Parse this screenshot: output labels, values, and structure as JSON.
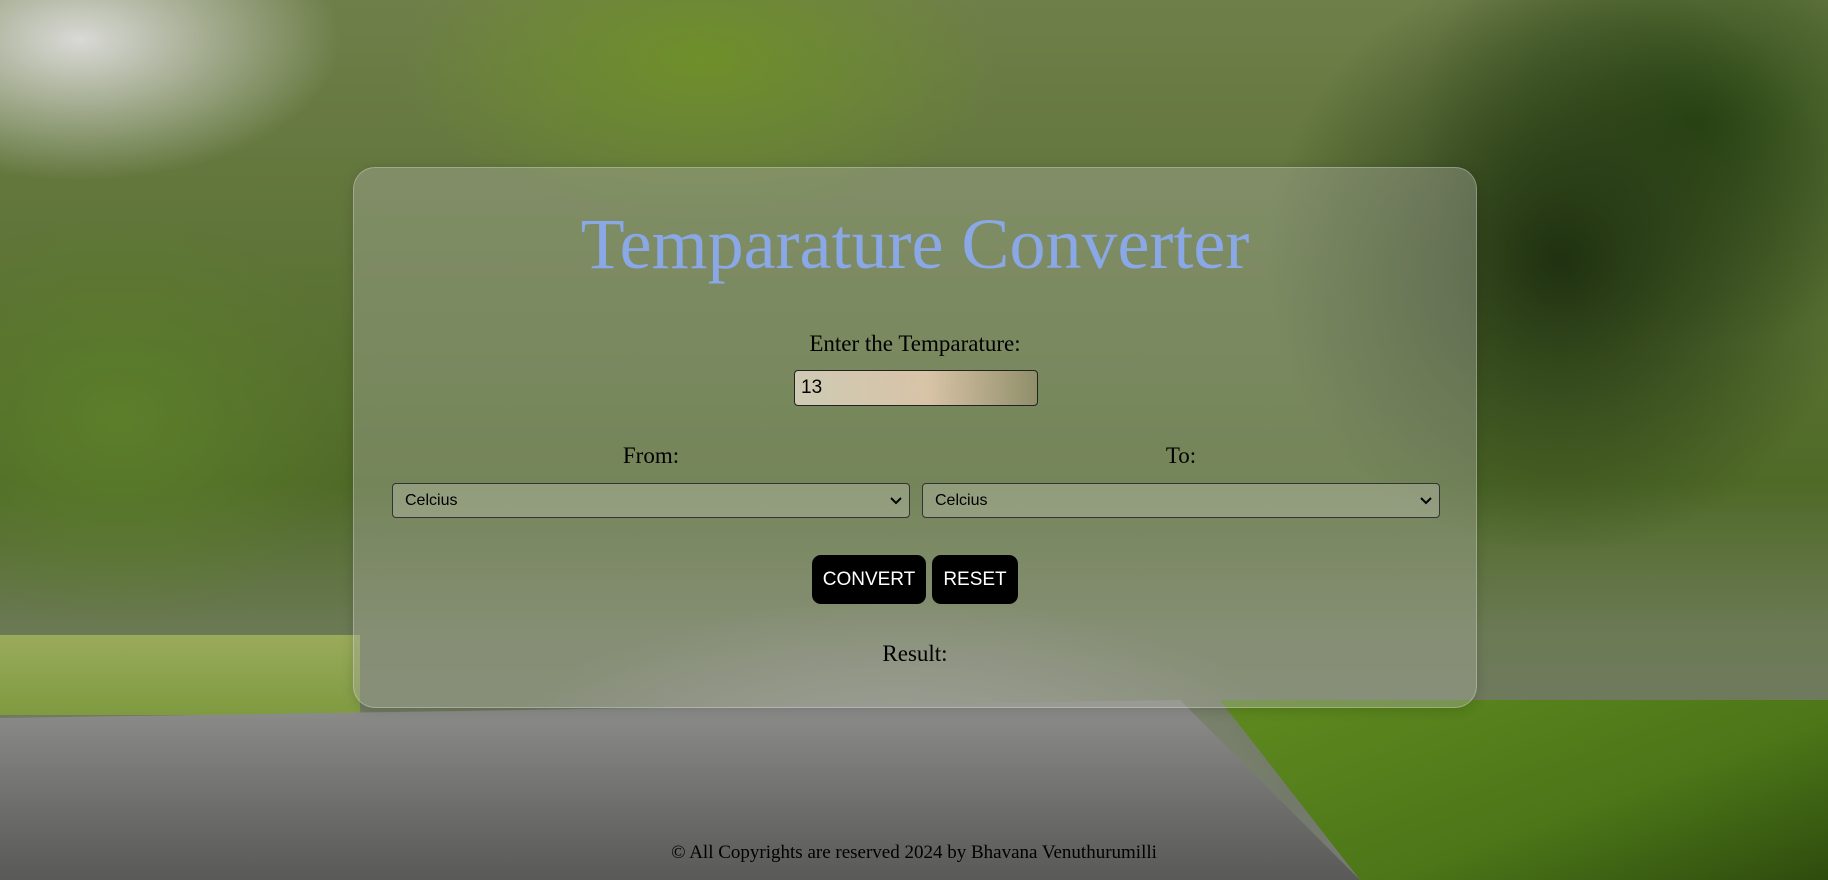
{
  "title": "Temparature Converter",
  "input": {
    "label": "Enter the Temparature:",
    "value": "13"
  },
  "from": {
    "label": "From:",
    "selected": "Celcius"
  },
  "to": {
    "label": "To:",
    "selected": "Celcius"
  },
  "buttons": {
    "convert": "CONVERT",
    "reset": "RESET"
  },
  "result": {
    "label": "Result:"
  },
  "footer": {
    "text": "© All Copyrights are reserved 2024 by Bhavana Venuthurumilli"
  },
  "colors": {
    "title": "#8aa8e6",
    "button_bg": "#000000",
    "button_text": "#ffffff"
  },
  "icons": {
    "select_arrow": "chevron-down-icon"
  }
}
